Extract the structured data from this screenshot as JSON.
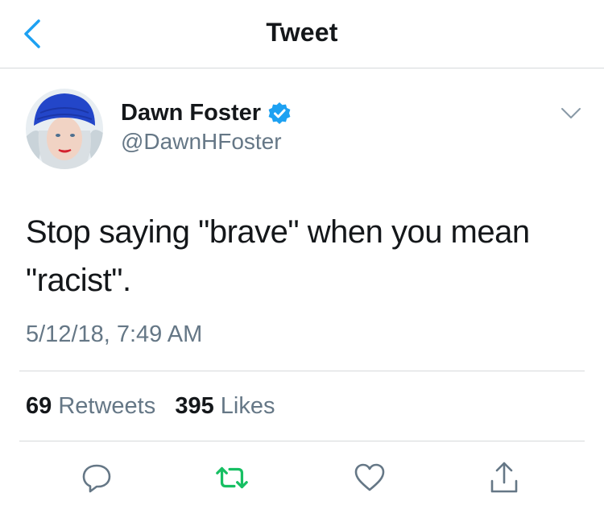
{
  "header": {
    "title": "Tweet"
  },
  "author": {
    "name": "Dawn Foster",
    "handle": "@DawnHFoster",
    "verified": true
  },
  "tweet": {
    "text_line1": "Stop saying \"brave\" when you mean",
    "text_line2": "\"racist\".",
    "timestamp": "5/12/18, 7:49 AM"
  },
  "stats": {
    "retweets_count": "69",
    "retweets_label": "Retweets",
    "likes_count": "395",
    "likes_label": "Likes"
  },
  "icons": {
    "back": "chevron-left-icon",
    "verified": "verified-badge-icon",
    "more": "chevron-down-icon",
    "reply": "reply-icon",
    "retweet": "retweet-icon",
    "like": "heart-icon",
    "share": "share-icon"
  },
  "colors": {
    "accent": "#1da1f2",
    "retweet_green": "#17bf63",
    "secondary_text": "#657786",
    "divider": "#d6d9db"
  }
}
